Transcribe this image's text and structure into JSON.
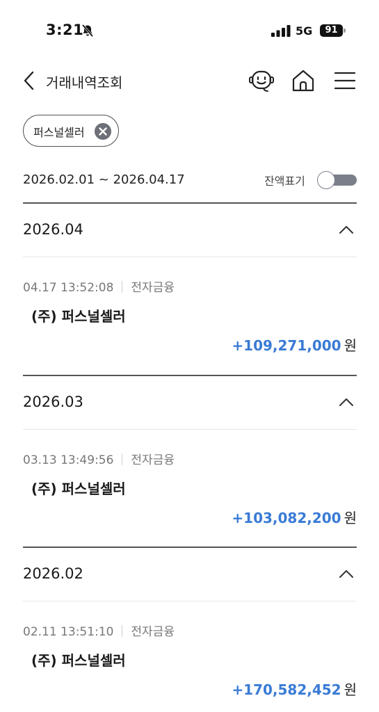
{
  "status_bar": {
    "time": "3:21",
    "network": "5G",
    "battery": "91"
  },
  "header": {
    "title": "거래내역조회",
    "icons": [
      "chevron-left-icon",
      "chatbot-icon",
      "home-icon",
      "menu-icon"
    ]
  },
  "filter": {
    "chip_label": "퍼스널셀러"
  },
  "date_range": "2026.02.01 ~ 2026.04.17",
  "balance_toggle": {
    "label": "잔액표기",
    "on": false
  },
  "colors": {
    "amount": "#3a7bd5",
    "divider": "#555555",
    "toggle": "#7b7f89"
  },
  "months": [
    {
      "label": "2026.04",
      "transaction": {
        "datetime": "04.17 13:52:08",
        "type": "전자금융",
        "name": "(주) 퍼스널셀러",
        "amount": "+109,271,000",
        "unit": "원"
      }
    },
    {
      "label": "2026.03",
      "transaction": {
        "datetime": "03.13 13:49:56",
        "type": "전자금융",
        "name": "(주) 퍼스널셀러",
        "amount": "+103,082,200",
        "unit": "원"
      }
    },
    {
      "label": "2026.02",
      "transaction": {
        "datetime": "02.11 13:51:10",
        "type": "전자금융",
        "name": "(주) 퍼스널셀러",
        "amount": "+170,582,452",
        "unit": "원"
      }
    }
  ]
}
